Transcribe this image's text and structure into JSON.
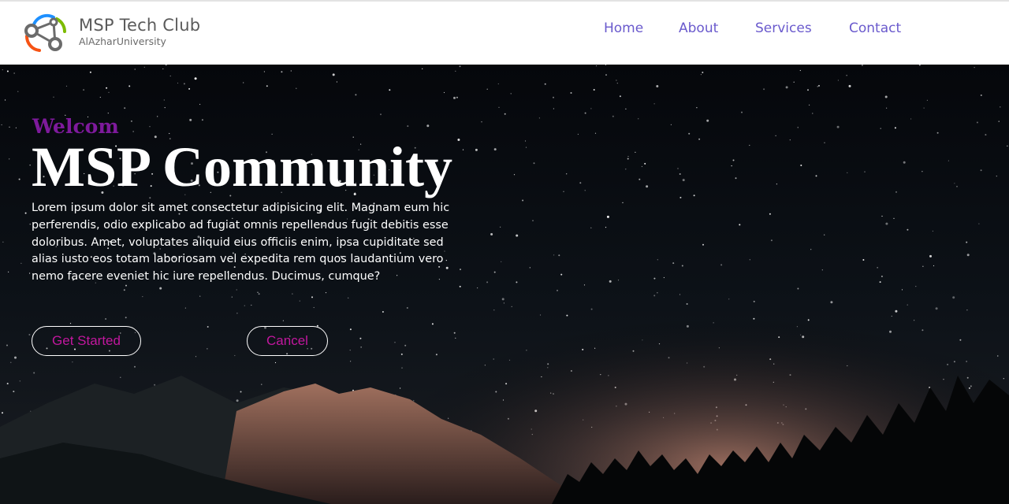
{
  "header": {
    "brand_title": "MSP Tech Club",
    "brand_subtitle": "AlAzharUniversity",
    "logo_icon": "msp-molecule-logo-icon",
    "nav": [
      {
        "label": "Home"
      },
      {
        "label": "About"
      },
      {
        "label": "Services"
      },
      {
        "label": "Contact"
      }
    ],
    "nav_color": "#6a5acd"
  },
  "hero": {
    "welcome": "Welcom",
    "title": "MSP Community",
    "description": "Lorem ipsum dolor sit amet consectetur adipisicing elit. Magnam eum hic perferendis, odio explicabo ad fugiat omnis repellendus fugit debitis esse doloribus. Amet, voluptates aliquid eius officiis enim, ipsa cupiditate sed alias iusto eos totam laboriosam vel expedita rem quos laudantium vero nemo facere eveniet hic iure repellendus. Ducimus, cumque?",
    "buttons": {
      "primary": "Get Started",
      "secondary": "Cancel"
    },
    "background": "starry-night-mountain-image",
    "colors": {
      "welcome": "#7e1a9c",
      "button_text": "#c2179e"
    }
  }
}
